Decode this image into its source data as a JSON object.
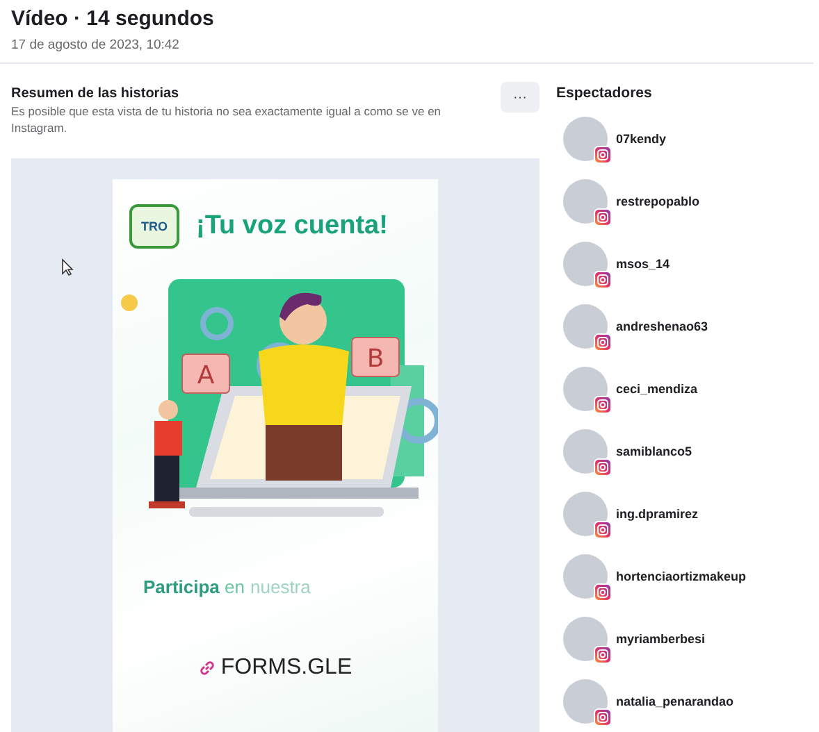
{
  "header": {
    "title": "Vídeo · 14 segundos",
    "date": "17 de agosto de 2023, 10:42"
  },
  "summary": {
    "title": "Resumen de las historias",
    "description": "Es posible que esta vista de tu historia no sea exactamente igual a como se ve en Instagram.",
    "more_button": "···"
  },
  "story": {
    "logo_text": "TRO",
    "headline": "¡Tu voz cuenta!",
    "card_letters": [
      "A",
      "B"
    ],
    "tagline": "**Participa** en",
    "tagline_faded": "nuestra",
    "link": "FORMS.GLE"
  },
  "viewers": {
    "title": "Espectadores",
    "items": [
      {
        "name": "07kendy"
      },
      {
        "name": "restrepopablo"
      },
      {
        "name": "msos_14"
      },
      {
        "name": "andreshenao63"
      },
      {
        "name": "ceci_mendiza"
      },
      {
        "name": "samiblanco5"
      },
      {
        "name": "ing.dpramirez"
      },
      {
        "name": "hortenciaortizmakeup"
      },
      {
        "name": "myriamberbesi"
      },
      {
        "name": "natalia_penarandao"
      }
    ]
  }
}
